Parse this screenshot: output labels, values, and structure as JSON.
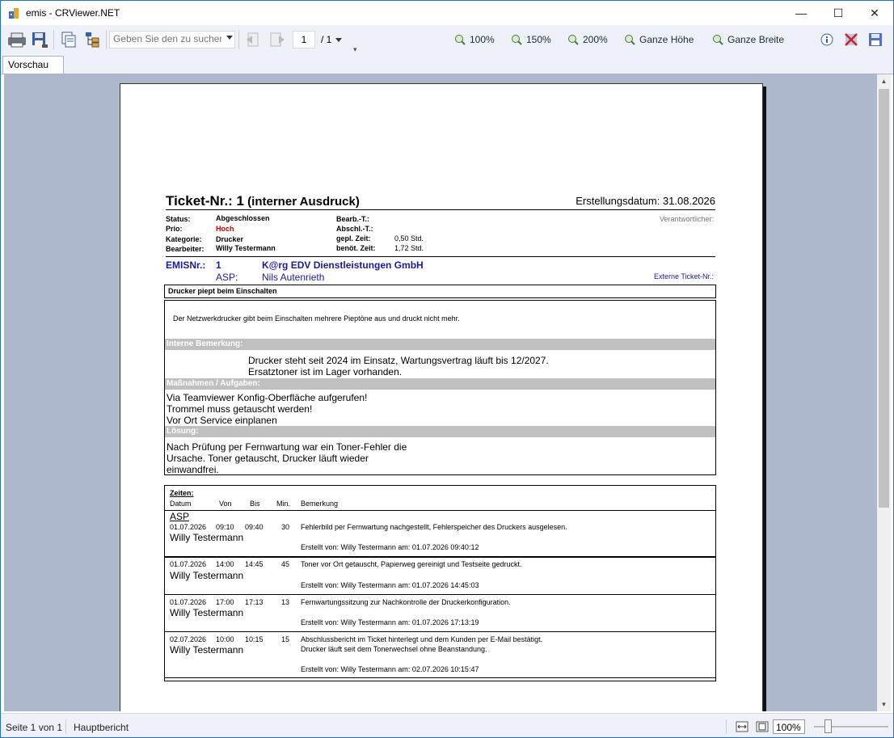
{
  "window": {
    "title": "emis - CRViewer.NET",
    "minimize": "—",
    "maximize": "☐",
    "close": "✕"
  },
  "toolbar": {
    "search_placeholder": "Geben Sie den zu suchenden Text ein",
    "page_current": "1",
    "page_total": "/ 1",
    "zoom_100": "100%",
    "zoom_150": "150%",
    "zoom_200": "200%",
    "zoom_full_height": "Ganze Höhe",
    "zoom_full_width": "Ganze Breite"
  },
  "tabs": [
    {
      "label": "Vorschau"
    }
  ],
  "report": {
    "title_bold": "Ticket-Nr.: 1",
    "title_suffix": " (interner Ausdruck)",
    "created": "Erstellungsdatum: 31.08.2026",
    "status_label": "Status:",
    "status_value": "Abgeschlossen",
    "prio_label": "Prio:",
    "prio_value": "Hoch",
    "category_label": "Kategorie:",
    "category_value": "Drucker",
    "editor_label": "Bearbeiter:",
    "editor_value": "Willy Testermann",
    "bearb_label": "Bearb.-T.:",
    "abschl_label": "Abschl.-T.:",
    "planned_label": "gepl. Zeit:",
    "planned_value": "0,50 Std.",
    "needed_label": "benöt. Zeit:",
    "needed_value": "1,72 Std.",
    "responsible_label": "Verantwortlicher:",
    "emis_label": "EMISNr.:",
    "emis_value": "1",
    "customer": "K@rg EDV Dienstleistungen GmbH",
    "asp_label": "ASP:",
    "asp_value": "Nils Autenrieth",
    "ext_ticket_label": "Externe Ticket-Nr.:",
    "subject": "Drucker piept beim Einschalten",
    "description": "Der Netzwerkdrucker gibt beim Einschalten mehrere Pieptöne aus und druckt nicht mehr.",
    "internal_label": "Interne Bemerkung:",
    "internal_line1": "Drucker steht seit 2024 im Einsatz, Wartungsvertrag läuft bis 12/2027.",
    "internal_line2": "Ersatztoner ist im Lager vorhanden.",
    "measures_label": "Maßnahmen / Aufgaben:",
    "measures": [
      "Via Teamviewer Konfig-Oberfläche aufgerufen!",
      "Trommel muss getauscht werden!",
      "Vor Ort Service einplanen"
    ],
    "solution_label": "Lösung:",
    "solution": [
      "Nach Prüfung per Fernwartung war ein Toner-Fehler die",
      "Ursache. Toner getauscht, Drucker läuft wieder",
      "einwandfrei."
    ],
    "times_label": "Zeiten:",
    "col_date": "Datum",
    "col_from": "Von",
    "col_to": "Bis",
    "col_min": "Min.",
    "col_note": "Bemerkung",
    "group_label": "ASP",
    "entries": [
      {
        "date": "01.07.2026",
        "from": "09:10",
        "to": "09:40",
        "min": "30",
        "person": "Willy Testermann",
        "note1": "Fehlerbild per Fernwartung nachgestellt, Fehlerspeicher des Druckers ausgelesen.",
        "note2": "",
        "created": "Erstellt von: Willy Testermann am: 01.07.2026 09:40:12"
      },
      {
        "date": "01.07.2026",
        "from": "14:00",
        "to": "14:45",
        "min": "45",
        "person": "Willy Testermann",
        "note1": "Toner vor Ort getauscht, Papierweg gereinigt und Testseite gedruckt.",
        "note2": "",
        "created": "Erstellt von: Willy Testermann am: 01.07.2026 14:45:03"
      },
      {
        "date": "01.07.2026",
        "from": "17:00",
        "to": "17:13",
        "min": "13",
        "person": "Willy Testermann",
        "note1": "Fernwartungssitzung zur Nachkontrolle der Druckerkonfiguration.",
        "note2": "",
        "created": "Erstellt von: Willy Testermann am: 01.07.2026 17:13:19"
      },
      {
        "date": "02.07.2026",
        "from": "10:00",
        "to": "10:15",
        "min": "15",
        "person": "Willy Testermann",
        "note1": "Abschlussbericht im Ticket hinterlegt und dem Kunden per E-Mail bestätigt.",
        "note2": "Drucker läuft seit dem Tonerwechsel ohne Beanstandung.",
        "created": "Erstellt von: Willy Testermann am: 02.07.2026 10:15:47"
      }
    ]
  },
  "status": {
    "page": "Seite 1 von 1",
    "report": "Hauptbericht",
    "zoom": "100%"
  },
  "colors": {
    "accent": "#1f6fd1",
    "prio_red": "#d00000",
    "emis_blue": "#1a1aa0",
    "viewport_bg": "#aeb8cc"
  }
}
